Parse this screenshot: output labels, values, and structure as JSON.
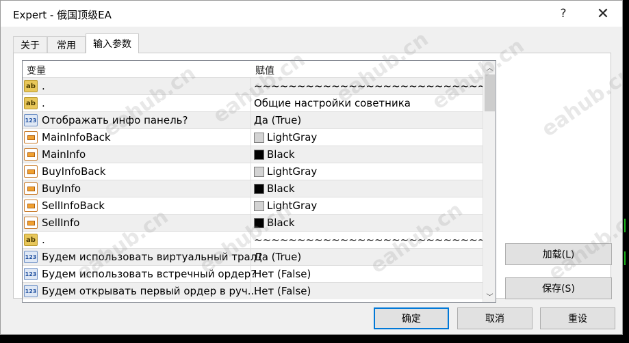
{
  "window": {
    "title": "Expert - 俄国顶级EA",
    "help_label": "?",
    "close_label": "✕"
  },
  "tabs": [
    {
      "label": "关于",
      "active": false
    },
    {
      "label": "常用",
      "active": false
    },
    {
      "label": "输入参数",
      "active": true
    }
  ],
  "grid": {
    "col_variable": "变量",
    "col_value": "赋值",
    "rows": [
      {
        "icon": "ab-string-icon",
        "name": ".",
        "value": "~~~~~~~~~~~~~~~~~~~~~~~~~~~~~..."
      },
      {
        "icon": "ab-string-icon",
        "name": ".",
        "value": "Общие настройки советника"
      },
      {
        "icon": "123-bool-icon",
        "name": "Отображать инфо панель?",
        "value": "Да  (True)"
      },
      {
        "icon": "color-icon",
        "name": "MainInfoBack",
        "value": "LightGray",
        "swatch": "#d3d3d3"
      },
      {
        "icon": "color-icon",
        "name": "MainInfo",
        "value": "Black",
        "swatch": "#000000"
      },
      {
        "icon": "color-icon",
        "name": "BuyInfoBack",
        "value": "LightGray",
        "swatch": "#d3d3d3"
      },
      {
        "icon": "color-icon",
        "name": "BuyInfo",
        "value": "Black",
        "swatch": "#000000"
      },
      {
        "icon": "color-icon",
        "name": "SellInfoBack",
        "value": "LightGray",
        "swatch": "#d3d3d3"
      },
      {
        "icon": "color-icon",
        "name": "SellInfo",
        "value": "Black",
        "swatch": "#000000"
      },
      {
        "icon": "ab-string-icon",
        "name": ".",
        "value": "~~~~~~~~~~~~~~~~~~~~~~~~~~~~~..."
      },
      {
        "icon": "123-bool-icon",
        "name": "Будем использовать виртуальный трал?",
        "value": "Да  (True)"
      },
      {
        "icon": "123-bool-icon",
        "name": "Будем использовать встречный ордер?",
        "value": "Нет (False)"
      },
      {
        "icon": "123-bool-icon",
        "name": "Будем открывать первый ордер в руч...",
        "value": "Нет (False)"
      }
    ]
  },
  "buttons": {
    "load": "加载(L)",
    "save": "保存(S)",
    "ok": "确定",
    "cancel": "取消",
    "reset": "重设"
  },
  "watermark": "eahub.cn",
  "colors": {
    "default_button_border": "#0078d7",
    "alt_row": "#efefef"
  }
}
